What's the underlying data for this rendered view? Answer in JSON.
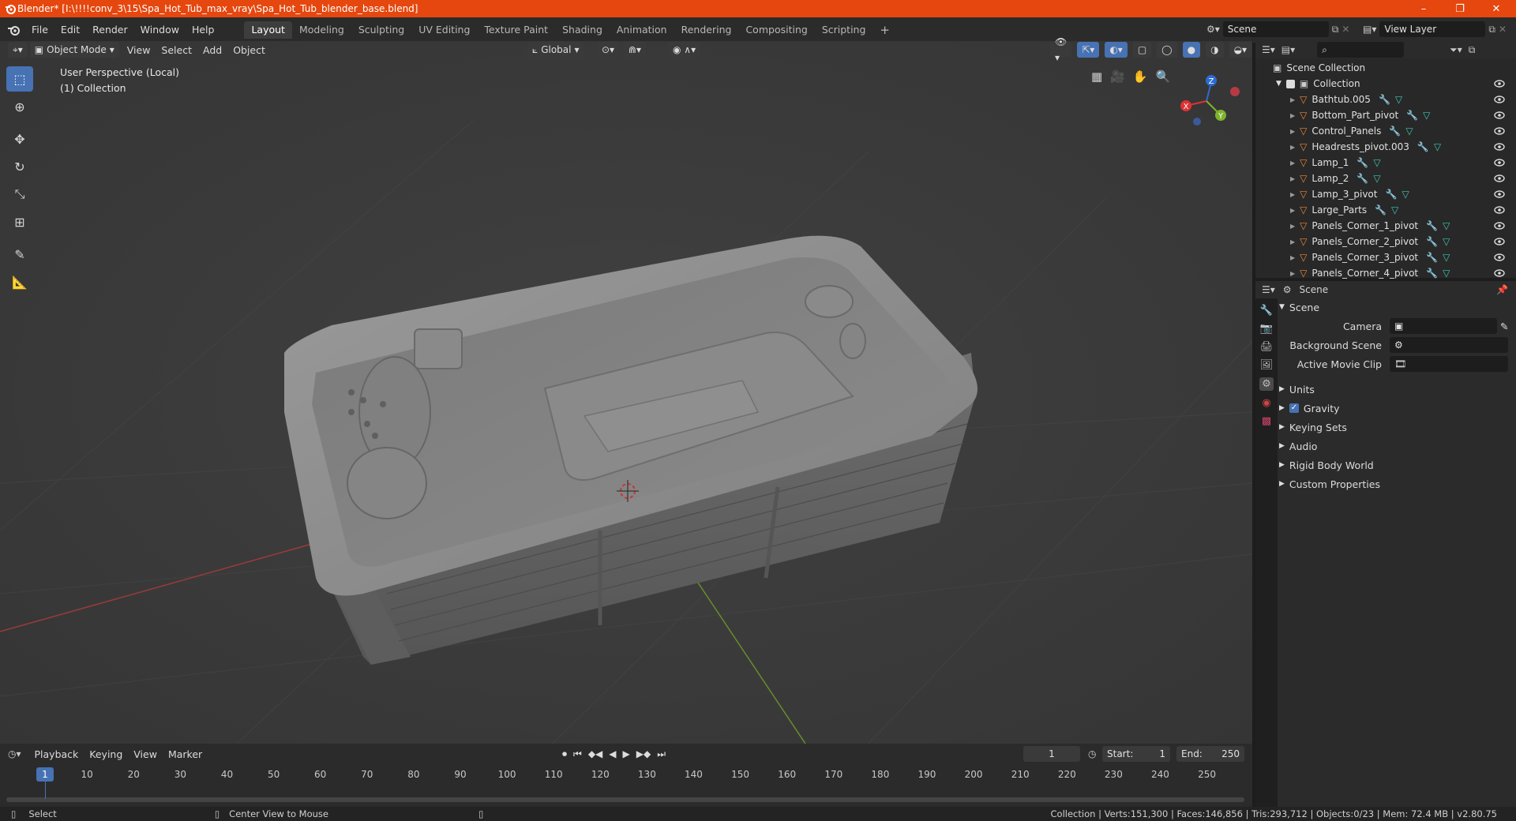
{
  "window": {
    "title": "Blender* [I:\\!!!!conv_3\\15\\Spa_Hot_Tub_max_vray\\Spa_Hot_Tub_blender_base.blend]",
    "controls": [
      "–",
      "❐",
      "✕"
    ]
  },
  "menu": [
    "File",
    "Edit",
    "Render",
    "Window",
    "Help"
  ],
  "workspaces": [
    {
      "label": "Layout",
      "active": true
    },
    {
      "label": "Modeling"
    },
    {
      "label": "Sculpting"
    },
    {
      "label": "UV Editing"
    },
    {
      "label": "Texture Paint"
    },
    {
      "label": "Shading"
    },
    {
      "label": "Animation"
    },
    {
      "label": "Rendering"
    },
    {
      "label": "Compositing"
    },
    {
      "label": "Scripting"
    }
  ],
  "scene_field": "Scene",
  "view_layer_field": "View Layer",
  "viewport_header": {
    "mode": "Object Mode",
    "menus": [
      "View",
      "Select",
      "Add",
      "Object"
    ],
    "transform": "Global"
  },
  "viewport": {
    "perspective": "User Perspective (Local)",
    "collection": "(1) Collection",
    "axes": {
      "x": "X",
      "y": "Y",
      "z": "Z"
    }
  },
  "outliner": {
    "root": "Scene Collection",
    "collection": "Collection",
    "objects": [
      "Bathtub.005",
      "Bottom_Part_pivot",
      "Control_Panels",
      "Headrests_pivot.003",
      "Lamp_1",
      "Lamp_2",
      "Lamp_3_pivot",
      "Large_Parts",
      "Panels_Corner_1_pivot",
      "Panels_Corner_2_pivot",
      "Panels_Corner_3_pivot",
      "Panels_Corner_4_pivot"
    ]
  },
  "properties": {
    "context": "Scene",
    "panel": "Scene",
    "camera_label": "Camera",
    "background_label": "Background Scene",
    "movieclip_label": "Active Movie Clip",
    "sections": [
      "Units",
      "Gravity",
      "Keying Sets",
      "Audio",
      "Rigid Body World",
      "Custom Properties"
    ],
    "gravity_checked": true
  },
  "timeline": {
    "menus": [
      "Playback",
      "Keying",
      "View",
      "Marker"
    ],
    "current_frame": "1",
    "start_label": "Start:",
    "start": "1",
    "end_label": "End:",
    "end": "250",
    "ticks": [
      "1",
      "10",
      "20",
      "30",
      "40",
      "50",
      "60",
      "70",
      "80",
      "90",
      "100",
      "110",
      "120",
      "130",
      "140",
      "150",
      "160",
      "170",
      "180",
      "190",
      "200",
      "210",
      "220",
      "230",
      "240",
      "250"
    ]
  },
  "status": {
    "left": "Select",
    "middle": "Center View to Mouse",
    "right": "Collection | Verts:151,300 | Faces:146,856 | Tris:293,712 | Objects:0/23 | Mem: 72.4 MB | v2.80.75"
  },
  "colors": {
    "accent": "#4772b3",
    "title": "#e5470f",
    "object_icon": "#e8893a",
    "mesh_icon": "#3fc7b0",
    "modifier_icon": "#6fa3e8"
  }
}
